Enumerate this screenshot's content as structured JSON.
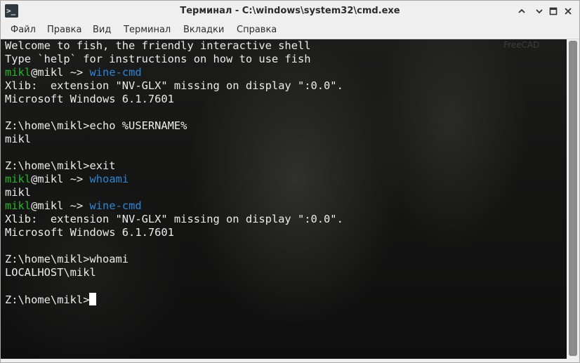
{
  "window": {
    "title": "Терминал - C:\\windows\\system32\\cmd.exe",
    "app_icon": "terminal-icon",
    "app_icon_glyph": ">_",
    "controls": [
      "chevron-up-icon",
      "chevron-down-icon",
      "maximize-icon",
      "close-icon"
    ]
  },
  "menu": {
    "items": [
      {
        "label": "Файл"
      },
      {
        "label": "Правка"
      },
      {
        "label": "Вид"
      },
      {
        "label": "Терминал"
      },
      {
        "label": "Вкладки"
      },
      {
        "label": "Справка"
      }
    ]
  },
  "terminal": {
    "watermark": "FreeCAD",
    "colors": {
      "text": "#ececec",
      "prompt_user": "#23b823",
      "command": "#2c86d6",
      "cursor": "#ffffff"
    },
    "lines": [
      {
        "type": "text",
        "text": "Welcome to fish, the friendly interactive shell"
      },
      {
        "type": "text",
        "text": "Type `help` for instructions on how to use fish"
      },
      {
        "type": "prompt",
        "user": "mikl",
        "at": "@",
        "host": "mikl",
        "dir": " ~> ",
        "command": "wine-cmd"
      },
      {
        "type": "text",
        "text": "Xlib:  extension \"NV-GLX\" missing on display \":0.0\"."
      },
      {
        "type": "text",
        "text": "Microsoft Windows 6.1.7601"
      },
      {
        "type": "text",
        "text": ""
      },
      {
        "type": "text",
        "text": "Z:\\home\\mikl>echo %USERNAME%"
      },
      {
        "type": "text",
        "text": "mikl"
      },
      {
        "type": "text",
        "text": ""
      },
      {
        "type": "text",
        "text": "Z:\\home\\mikl>exit"
      },
      {
        "type": "prompt",
        "user": "mikl",
        "at": "@",
        "host": "mikl",
        "dir": " ~> ",
        "command": "whoami"
      },
      {
        "type": "text",
        "text": "mikl"
      },
      {
        "type": "prompt",
        "user": "mikl",
        "at": "@",
        "host": "mikl",
        "dir": " ~> ",
        "command": "wine-cmd"
      },
      {
        "type": "text",
        "text": "Xlib:  extension \"NV-GLX\" missing on display \":0.0\"."
      },
      {
        "type": "text",
        "text": "Microsoft Windows 6.1.7601"
      },
      {
        "type": "text",
        "text": ""
      },
      {
        "type": "text",
        "text": "Z:\\home\\mikl>whoami"
      },
      {
        "type": "text",
        "text": "LOCALHOST\\mikl"
      },
      {
        "type": "text",
        "text": ""
      },
      {
        "type": "cursor",
        "text": "Z:\\home\\mikl>"
      }
    ]
  }
}
